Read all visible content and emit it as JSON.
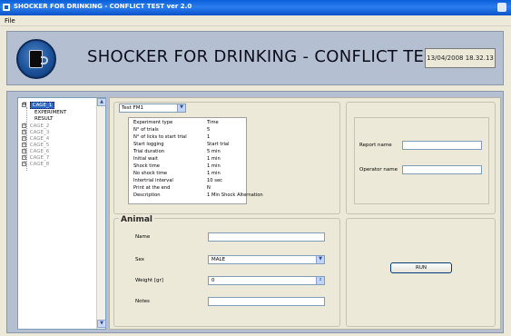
{
  "window": {
    "title": "SHOCKER FOR DRINKING - CONFLICT TEST ver 2.0"
  },
  "menu": {
    "file": "File"
  },
  "header": {
    "title": "SHOCKER FOR DRINKING - CONFLICT TEST",
    "datetime": "13/04/2008 18.32.13"
  },
  "tree": {
    "expand_symbol": "⊟",
    "collapse_symbol": "⊞",
    "selected_cage": "CAGE_1",
    "children": [
      "EXPERIMENT",
      "RESULT"
    ],
    "cages": [
      "CAGE_2",
      "CAGE_3",
      "CAGE_4",
      "CAGE_5",
      "CAGE_6",
      "CAGE_7",
      "CAGE_8"
    ],
    "scroll_up": "▲",
    "scroll_down": "▼"
  },
  "experiment": {
    "selected_test": "Test FM1",
    "dropdown_arrow": "▼",
    "params": [
      {
        "key": "Experiment type",
        "value": "Time"
      },
      {
        "key": "N° of trials",
        "value": "5"
      },
      {
        "key": "N° of licks to start trial",
        "value": "1"
      },
      {
        "key": "Start logging",
        "value": "Start trial"
      },
      {
        "key": "Trial duration",
        "value": "5 min"
      },
      {
        "key": "Initial wait",
        "value": "1 min"
      },
      {
        "key": "Shock time",
        "value": "1 min"
      },
      {
        "key": "No shock time",
        "value": "1 min"
      },
      {
        "key": "Intertrial interval",
        "value": "10 sec"
      },
      {
        "key": "Print at the end",
        "value": "N"
      },
      {
        "key": "Description",
        "value": "1 Min Shock Alternation"
      }
    ]
  },
  "report": {
    "report_name_label": "Report name",
    "report_name_value": "",
    "operator_name_label": "Operator name",
    "operator_name_value": ""
  },
  "animal": {
    "title": "Animal",
    "name_label": "Name",
    "name_value": "",
    "sex_label": "Sex",
    "sex_value": "MALE",
    "weight_label": "Weight [gr]",
    "weight_value": "0",
    "notes_label": "Notes",
    "notes_value": "",
    "spin_symbol": "⇕"
  },
  "run": {
    "label": "RUN"
  }
}
